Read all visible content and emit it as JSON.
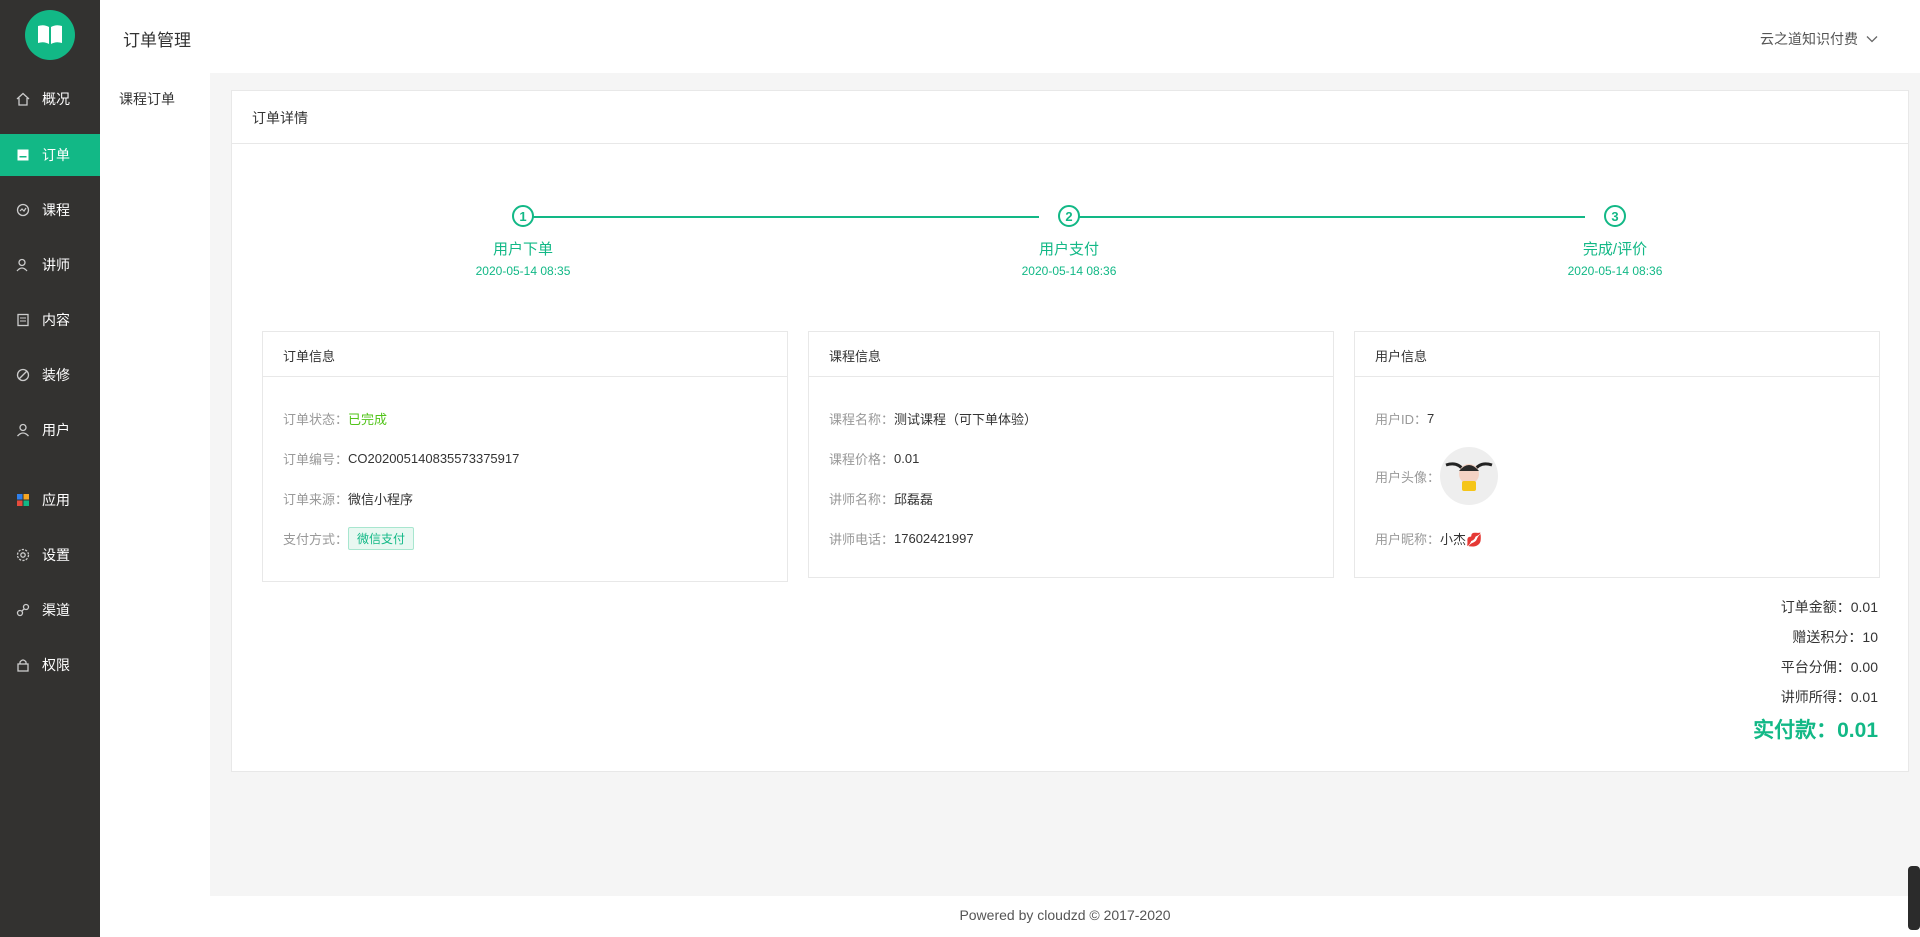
{
  "nav": {
    "items": [
      {
        "label": "概况",
        "icon": "home-icon"
      },
      {
        "label": "订单",
        "icon": "order-icon",
        "active": true
      },
      {
        "label": "课程",
        "icon": "course-icon"
      },
      {
        "label": "讲师",
        "icon": "teacher-icon"
      },
      {
        "label": "内容",
        "icon": "content-icon"
      },
      {
        "label": "装修",
        "icon": "decorate-icon"
      },
      {
        "label": "用户",
        "icon": "user-icon"
      },
      {
        "label": "应用",
        "icon": "apps-icon"
      },
      {
        "label": "设置",
        "icon": "settings-icon"
      },
      {
        "label": "渠道",
        "icon": "channel-icon"
      },
      {
        "label": "权限",
        "icon": "lock-icon"
      }
    ]
  },
  "subnav": {
    "item": "课程订单"
  },
  "header": {
    "title": "订单管理",
    "account": "云之道知识付费"
  },
  "card": {
    "title": "订单详情"
  },
  "steps": [
    {
      "num": "1",
      "title": "用户下单",
      "time": "2020-05-14 08:35"
    },
    {
      "num": "2",
      "title": "用户支付",
      "time": "2020-05-14 08:36"
    },
    {
      "num": "3",
      "title": "完成/评价",
      "time": "2020-05-14 08:36"
    }
  ],
  "order_info": {
    "title": "订单信息",
    "status_label": "订单状态：",
    "status": "已完成",
    "no_label": "订单编号：",
    "no": "CO202005140835573375917",
    "source_label": "订单来源：",
    "source": "微信小程序",
    "pay_label": "支付方式：",
    "pay": "微信支付"
  },
  "course_info": {
    "title": "课程信息",
    "name_label": "课程名称：",
    "name": "测试课程（可下单体验）",
    "price_label": "课程价格：",
    "price": "0.01",
    "teacher_label": "讲师名称：",
    "teacher": "邱磊磊",
    "phone_label": "讲师电话：",
    "phone": "17602421997"
  },
  "user_info": {
    "title": "用户信息",
    "id_label": "用户ID：",
    "id": "7",
    "avatar_label": "用户头像：",
    "nick_label": "用户昵称：",
    "nick": "小杰💋"
  },
  "summary": {
    "amount": "订单金额：0.01",
    "points": "赠送积分：10",
    "platform": "平台分佣：0.00",
    "teacher": "讲师所得：0.01",
    "paid": "实付款：0.01"
  },
  "footer": {
    "text": "Powered by cloudzd © 2017-2020"
  },
  "colors": {
    "accent": "#12b886",
    "sidebar": "#333230",
    "status_green": "#52c41a"
  }
}
